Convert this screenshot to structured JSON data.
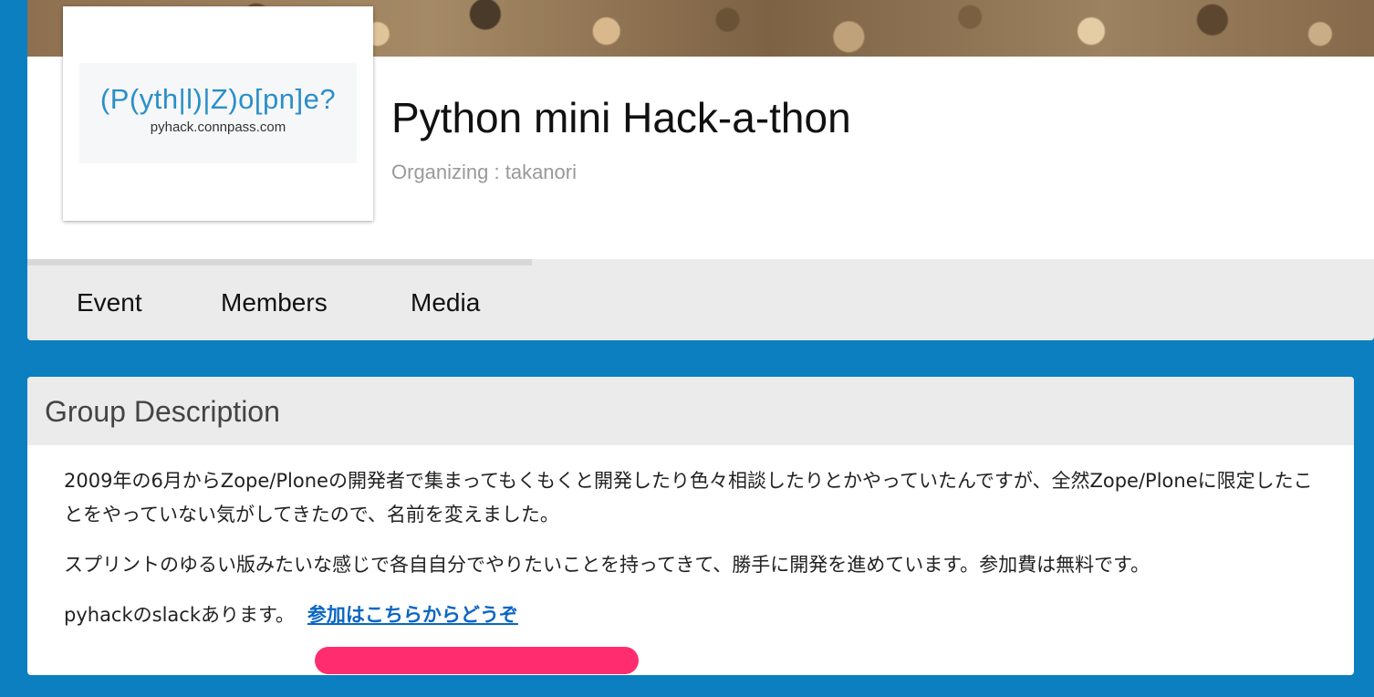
{
  "group": {
    "logo": {
      "main_text": "(P(yth|l)|Z)o[pn]e?",
      "sub_text": "pyhack.connpass.com"
    },
    "title": "Python mini Hack-a-thon",
    "organizing": "Organizing : takanori"
  },
  "nav": {
    "items": [
      {
        "label": "Event"
      },
      {
        "label": "Members"
      },
      {
        "label": "Media"
      }
    ]
  },
  "description": {
    "heading": "Group Description",
    "paragraphs": [
      "2009年の6月からZope/Ploneの開発者で集まってもくもくと開発したり色々相談したりとかやっていたんですが、全然Zope/Ploneに限定したことをやっていない気がしてきたので、名前を変えました。",
      "スプリントのゆるい版みたいな感じで各自自分でやりたいことを持ってきて、勝手に開発を進めています。参加費は無料です。"
    ],
    "slack_text": "pyhackのslackあります。",
    "join_link": "参加はこちらからどうぞ"
  },
  "colors": {
    "page_background": "#0b7fc0",
    "link": "#0a66c2",
    "highlight": "#ff2d6f",
    "logo_text": "#2a8fc9"
  }
}
